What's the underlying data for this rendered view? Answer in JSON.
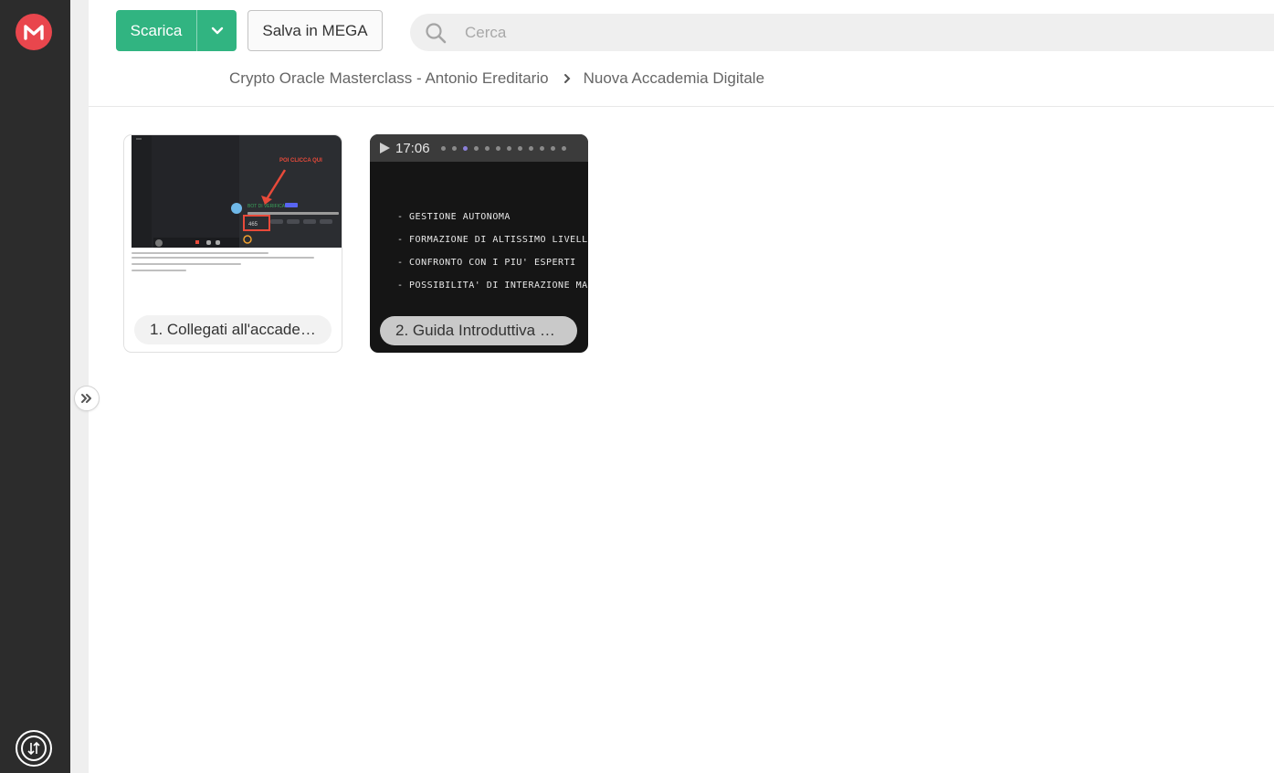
{
  "toolbar": {
    "download_label": "Scarica",
    "save_label": "Salva in MEGA"
  },
  "search": {
    "placeholder": "Cerca"
  },
  "breadcrumb": {
    "items": [
      "Crypto Oracle Masterclass - Antonio Ereditario",
      "Nuova Accademia Digitale"
    ]
  },
  "tiles": [
    {
      "label": "1. Collegati all'accade…",
      "thumbnail_text": {
        "callout": "POI CLICCA QUI",
        "bot_name": "BOT DI VERIFICA",
        "count": "465"
      }
    },
    {
      "label": "2. Guida Introduttiva …",
      "duration": "17:06",
      "bullets": [
        "- GESTIONE AUTONOMA",
        "- FORMAZIONE DI ALTISSIMO LIVELLO",
        "- CONFRONTO CON I PIU' ESPERTI",
        "- POSSIBILITA' DI INTERAZIONE MASS"
      ]
    }
  ],
  "colors": {
    "brand_red": "#e9464d",
    "download_green": "#31b481",
    "rail": "#2c2c2c"
  },
  "icons": [
    "mega-logo-icon",
    "chevron-down-icon",
    "search-icon",
    "chevron-right-icon",
    "double-chevron-right-icon",
    "transfer-icon",
    "play-icon"
  ]
}
